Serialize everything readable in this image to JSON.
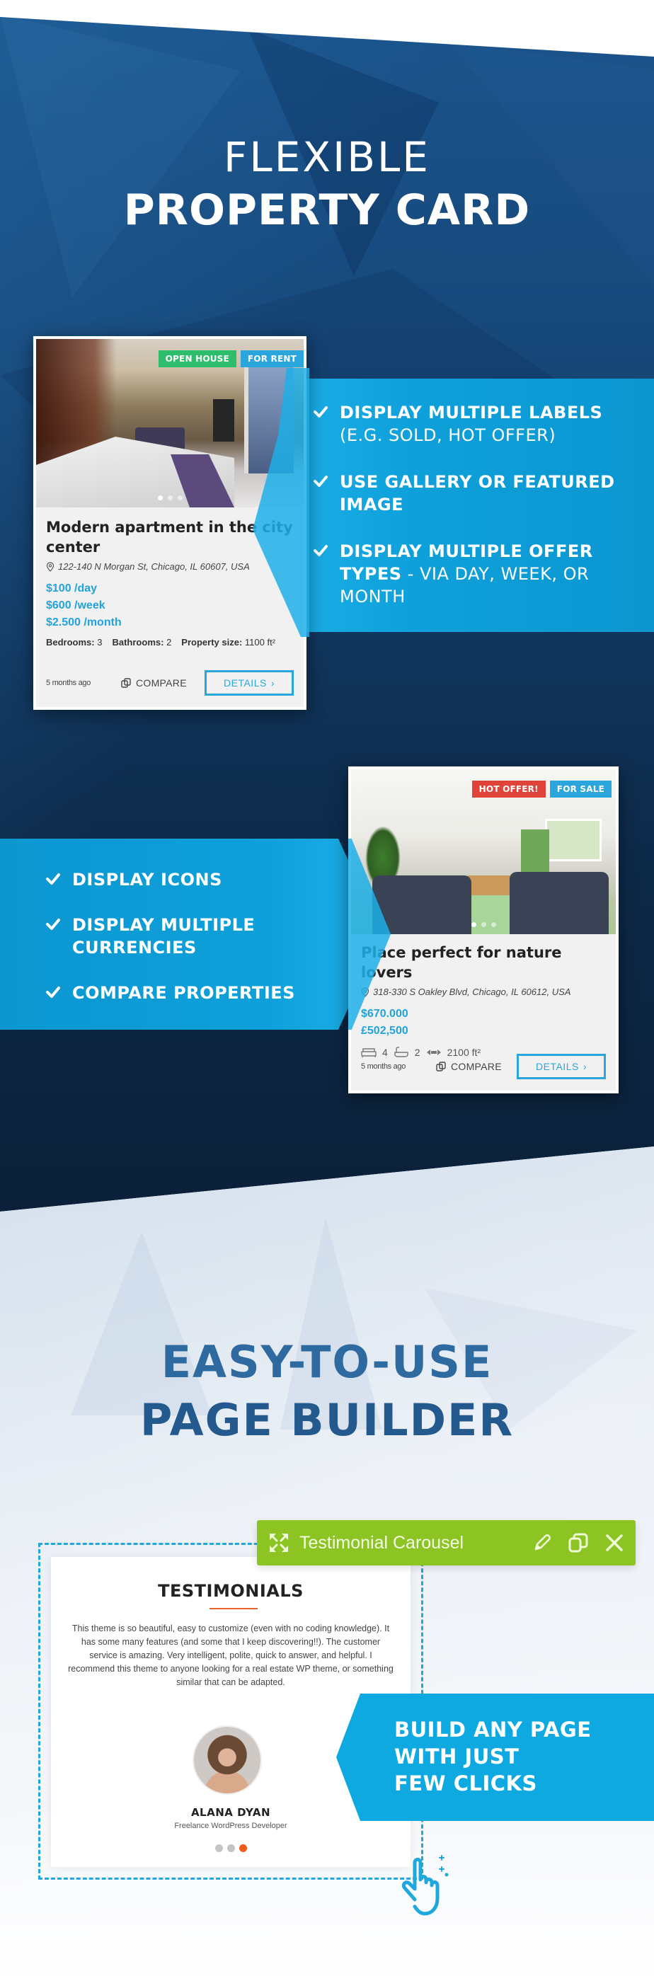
{
  "hero": {
    "title_line1": "FLEXIBLE",
    "title_line2": "PROPERTY CARD"
  },
  "features_top": [
    {
      "bold": "DISPLAY MULTIPLE LABELS",
      "regular": "(E.G. SOLD, HOT OFFER)"
    },
    {
      "bold": "USE GALLERY OR FEATURED IMAGE",
      "regular": ""
    },
    {
      "bold": "DISPLAY MULTIPLE OFFER TYPES",
      "regular": " - VIA DAY, WEEK, OR MONTH"
    }
  ],
  "features_bottom": [
    {
      "bold": "DISPLAY ICONS"
    },
    {
      "bold": "DISPLAY MULTIPLE CURRENCIES"
    },
    {
      "bold": "COMPARE PROPERTIES"
    }
  ],
  "card_1": {
    "labels": [
      {
        "text": "OPEN HOUSE",
        "color": "#2ebd6b"
      },
      {
        "text": "FOR RENT",
        "color": "#2aa6dc"
      }
    ],
    "gallery_dots": 3,
    "gallery_active": 1,
    "title": "Modern apartment in the city center",
    "address": "122-140 N Morgan St, Chicago, IL 60607, USA",
    "prices": [
      "$100 /day",
      "$600 /week",
      "$2.500 /month"
    ],
    "specs": [
      {
        "label": "Bedrooms:",
        "value": "3"
      },
      {
        "label": "Bathrooms:",
        "value": "2"
      },
      {
        "label": "Property size:",
        "value": "1100 ft²"
      }
    ],
    "posted": "5 months ago",
    "compare_label": "COMPARE",
    "details_label": "DETAILS"
  },
  "card_2": {
    "labels": [
      {
        "text": "HOT OFFER!",
        "color": "#e0433a"
      },
      {
        "text": "FOR SALE",
        "color": "#2aa6dc"
      }
    ],
    "gallery_dots": 3,
    "gallery_active": 1,
    "title": "Place perfect for nature lovers",
    "address": "318-330 S Oakley Blvd, Chicago, IL 60612, USA",
    "prices": [
      "$670.000",
      "£502,500"
    ],
    "icon_specs": {
      "bedrooms": "4",
      "bathrooms": "2",
      "size": "2100 ft²"
    },
    "posted": "5 months ago",
    "compare_label": "COMPARE",
    "details_label": "DETAILS"
  },
  "builder": {
    "title_line1": "EASY-TO-USE",
    "title_line2": "PAGE BUILDER",
    "toolbar_title": "Testimonial Carousel",
    "toolbar_color": "#8cc523",
    "cta_lines": [
      "BUILD ANY PAGE",
      "WITH JUST",
      "FEW CLICKS"
    ]
  },
  "testimonial": {
    "heading": "TESTIMONIALS",
    "quote": "This theme is so beautiful, easy to customize (even with no coding knowledge). It has some many features (and some that I keep discovering!!). The customer service is amazing. Very intelligent, polite, quick to answer, and helpful. I recommend this theme to anyone looking for a real estate WP theme, or something similar that can be adapted.",
    "name": "ALANA DYAN",
    "role": "Freelance WordPress Developer",
    "dots": 3,
    "active_dot": 3,
    "accent": "#f05a1a"
  },
  "colors": {
    "accent_blue": "#0fa9e2",
    "price_blue": "#22a3dc"
  }
}
